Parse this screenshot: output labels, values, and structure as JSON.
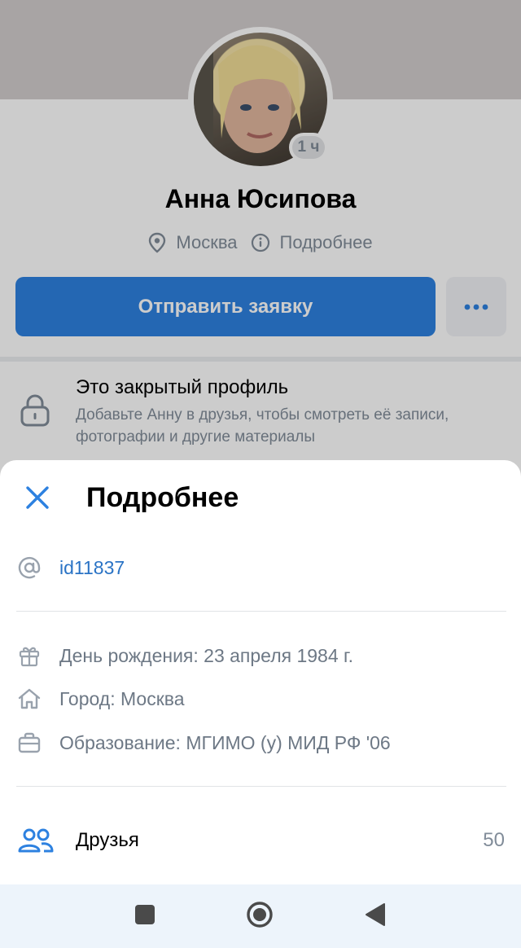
{
  "profile": {
    "name": "Анна Юсипова",
    "online_badge": "1 ч",
    "city": "Москва",
    "details_link": "Подробнее",
    "send_request_label": "Отправить заявку",
    "private_title": "Это закрытый профиль",
    "private_text": "Добавьте Анну в друзья, чтобы смотреть её записи, фотографии и другие материалы"
  },
  "sheet": {
    "title": "Подробнее",
    "user_id": "id11837",
    "birthday": "День рождения: 23 апреля 1984 г.",
    "city": "Город: Москва",
    "education": "Образование: МГИМО (у) МИД РФ  '06",
    "friends_label": "Друзья",
    "friends_count": "50"
  },
  "colors": {
    "accent": "#2d81e0",
    "link": "#2a73c5",
    "muted": "#818c99",
    "navbar": "#edf4fb"
  },
  "icons": {
    "location": "location-pin-icon",
    "info": "info-icon",
    "more": "more-dots-icon",
    "lock": "lock-icon",
    "close": "close-icon",
    "at": "at-sign-icon",
    "gift": "gift-icon",
    "home": "home-icon",
    "education": "briefcase-icon",
    "friends": "friends-icon",
    "nav_recent": "square-icon",
    "nav_home": "circle-home-icon",
    "nav_back": "back-triangle-icon"
  }
}
